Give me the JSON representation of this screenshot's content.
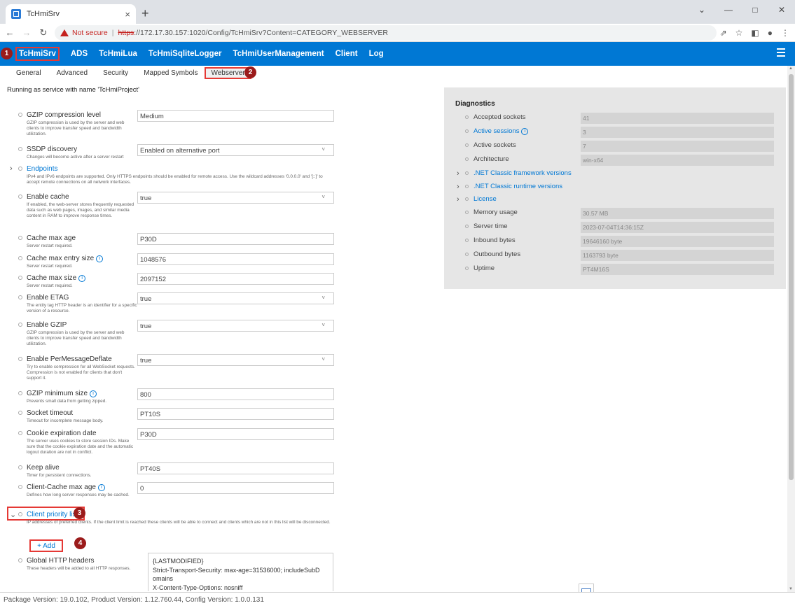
{
  "browser": {
    "tab_title": "TcHmiSrv",
    "tab_close": "×",
    "new_tab": "+",
    "not_secure": "Not secure",
    "url_scheme": "https",
    "url_rest": "://172.17.30.157:1020/Config/TcHmiSrv?Content=CATEGORY_WEBSERVER"
  },
  "appbar": {
    "items": [
      "TcHmiSrv",
      "ADS",
      "TcHmiLua",
      "TcHmiSqliteLogger",
      "TcHmiUserManagement",
      "Client",
      "Log"
    ]
  },
  "markers": [
    "1",
    "2",
    "3",
    "4"
  ],
  "subtabs": [
    "General",
    "Advanced",
    "Security",
    "Mapped Symbols",
    "Webserver"
  ],
  "running": "Running as service with name 'TcHmiProject'",
  "settings": [
    {
      "label": "GZIP compression level",
      "desc": "GZIP compression is used by the server and web clients to improve transfer speed and bandwidth utilization.",
      "value": "Medium"
    },
    {
      "label": "SSDP discovery",
      "desc": "Changes will become active after a server restart",
      "value": "Enabled on alternative port"
    },
    {
      "label": "Endpoints",
      "desc": "IPv4 and IPv6 endpoints are supported. Only HTTPS endpoints should be enabled for remote access. Use the wildcard addresses '0.0.0.0' and '[::]' to accept remote connections on all network interfaces."
    },
    {
      "label": "Enable cache",
      "desc": "If enabled, the web-server stores frequently requested data such as web pages, images, and similar media content in RAM to improve response times.",
      "value": "true"
    },
    {
      "label": "Cache max age",
      "desc": "Server restart required.",
      "value": "P30D"
    },
    {
      "label": "Cache max entry size",
      "desc": "Server restart required.",
      "value": "1048576"
    },
    {
      "label": "Cache max size",
      "desc": "Server restart required.",
      "value": "2097152"
    },
    {
      "label": "Enable ETAG",
      "desc": "The entity tag HTTP header is an identifier for a specific version of a resource.",
      "value": "true"
    },
    {
      "label": "Enable GZIP",
      "desc": "GZIP compression is used by the server and web clients to improve transfer speed and bandwidth utilization.",
      "value": "true"
    },
    {
      "label": "Enable PerMessageDeflate",
      "desc": "Try to enable compression for all WebSocket requests. Compression is not enabled for clients that don't support it.",
      "value": "true"
    },
    {
      "label": "GZIP minimum size",
      "desc": "Prevents small data from getting zipped.",
      "value": "800"
    },
    {
      "label": "Socket timeout",
      "desc": "Timeout for incomplete message body.",
      "value": "PT10S"
    },
    {
      "label": "Cookie expiration date",
      "desc": "The server uses cookies to store session IDs. Make sure that the cookie expiration date and the automatic logout duration are not in conflict.",
      "value": "P30D"
    },
    {
      "label": "Keep alive",
      "desc": "Timer for persistent connections.",
      "value": "PT40S"
    },
    {
      "label": "Client-Cache max age",
      "desc": "Defines how long server responses may be cached.",
      "value": "0"
    },
    {
      "label": "Client priority list",
      "desc": "IP addresses of preferred clients. If the client limit is reached these clients will be able to connect and clients which are not in this list will be disconnected."
    },
    {
      "label": "Global HTTP headers",
      "desc": "These headers will be added to all HTTP responses."
    }
  ],
  "add_button": "+ Add",
  "global_headers": [
    "{LASTMODIFIED}",
    "Strict-Transport-Security: max-age=31536000; includeSubD",
    "omains",
    "X-Content-Type-Options: nosniff"
  ],
  "diagnostics": {
    "title": "Diagnostics",
    "rows": [
      {
        "label": "Accepted sockets",
        "value": "41"
      },
      {
        "label": "Active sessions",
        "value": "3"
      },
      {
        "label": "Active sockets",
        "value": "7"
      },
      {
        "label": "Architecture",
        "value": "win-x64"
      },
      {
        "label": ".NET Classic framework versions"
      },
      {
        "label": ".NET Classic runtime versions"
      },
      {
        "label": "License"
      },
      {
        "label": "Memory usage",
        "value": "30.57 MB"
      },
      {
        "label": "Server time",
        "value": "2023-07-04T14:36:15Z"
      },
      {
        "label": "Inbound bytes",
        "value": "19646160 byte"
      },
      {
        "label": "Outbound bytes",
        "value": "1163793 byte"
      },
      {
        "label": "Uptime",
        "value": "PT4M16S"
      }
    ]
  },
  "footer": "Package Version: 19.0.102, Product Version: 1.12.760.44, Config Version: 1.0.0.131",
  "colors": {
    "accent": "#0078d4",
    "highlight": "#e53935",
    "marker": "#9b1b1b"
  }
}
